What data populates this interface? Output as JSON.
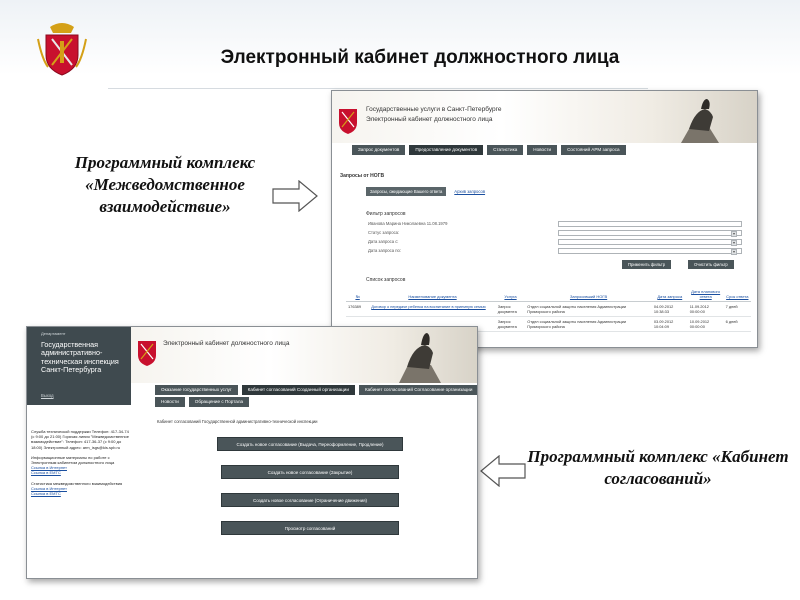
{
  "slide": {
    "title": "Электронный кабинет должностного лица",
    "caption_left": "Программный комплекс «Межведомственное взаимодействие»",
    "caption_right": "Программный комплекс «Кабинет согласований»"
  },
  "colors": {
    "header_gradient": "#eef2f6",
    "tab_dark": "#4a5559",
    "link_blue": "#1a4fa0",
    "coat_red": "#c8102e",
    "coat_gold": "#d4a017"
  },
  "screen_nogv": {
    "banner_line1": "Государственные услуги в Санкт-Петербурге",
    "banner_line2": "Электронный кабинет должностного лица",
    "tabs": [
      "Запрос документов",
      "Предоставление документов",
      "Статистика",
      "Новости",
      "Состояний АРМ запроса"
    ],
    "section_title": "Запросы от НОГВ",
    "subtabs": [
      "Запросы, ожидающие Вашего ответа",
      "Архив запросов"
    ],
    "filter_title": "Фильтр запросов",
    "filter_user": "Иванова Марина Николаевна 11.08.1979",
    "filter_rows": [
      "Статус запроса:",
      "Дата запроса с:",
      "Дата запроса по:"
    ],
    "apply_button": "Применить фильтр",
    "reset_button": "Очистить фильтр",
    "list_title": "Список запросов",
    "table_headers": [
      "№",
      "Наименование документа",
      "Услуга",
      "Запросивший НОГВ",
      "Дата запроса",
      "Дата планового ответа",
      "Срок ответа"
    ],
    "rows": [
      [
        "176389",
        "Договор о передаче ребенка на воспитание в приемную семью",
        "Запрос документа",
        "Отдел социальной защиты населения Администрации Приморского района",
        "04.09.2012 10:38:33",
        "11.09.2012 00:00:00",
        "7 дней"
      ],
      [
        "",
        "",
        "Запрос документа",
        "Отдел социальной защиты населения Администрации Приморского района",
        "03.09.2012 10:04:09",
        "10.09.2012 00:00:00",
        "6 дней"
      ]
    ]
  },
  "screen_kabinet": {
    "side_small": "Департамент",
    "side_title": "Государственная административно-техническая инспекция Санкт-Петербурга",
    "home_link": "Выход",
    "banner_title": "Электронный кабинет должностного лица",
    "tabs_row1": [
      "Оказание государственных услуг",
      "Кабинет согласований Созданный организации",
      "Кабинет согласований Согласование организации"
    ],
    "tabs_row2": [
      "Новости",
      "Обращение с Портала"
    ],
    "content_title": "Кабинет согласований Государственной административно-технической инспекции",
    "buttons": [
      "Создать новое согласование (Выдача, Переоформление, Продление)",
      "Создать новое согласование (Закрытие)",
      "Создать новое согласование (Ограничение движения)",
      "Просмотр согласований"
    ],
    "support": "Служба технической поддержки Телефон: 417-34-74 (с 9:00 до 21:00) Горячая линия \"Межведомственное взаимодействие\": Телефон: 417-36-37 (с 9:00 до 18:00) Электронный адрес: arm_isgs@kis.spb.ru",
    "info": "Информационные материалы по работе с Электронным кабинетом должностного лица",
    "info_links": [
      "Ссылка в Интернет",
      "Ссылка в ЕМТС"
    ],
    "stats": "Статистика межведомственного взаимодействия",
    "stats_links": [
      "Ссылка в Интернет",
      "Ссылка в ЕМТС"
    ]
  }
}
